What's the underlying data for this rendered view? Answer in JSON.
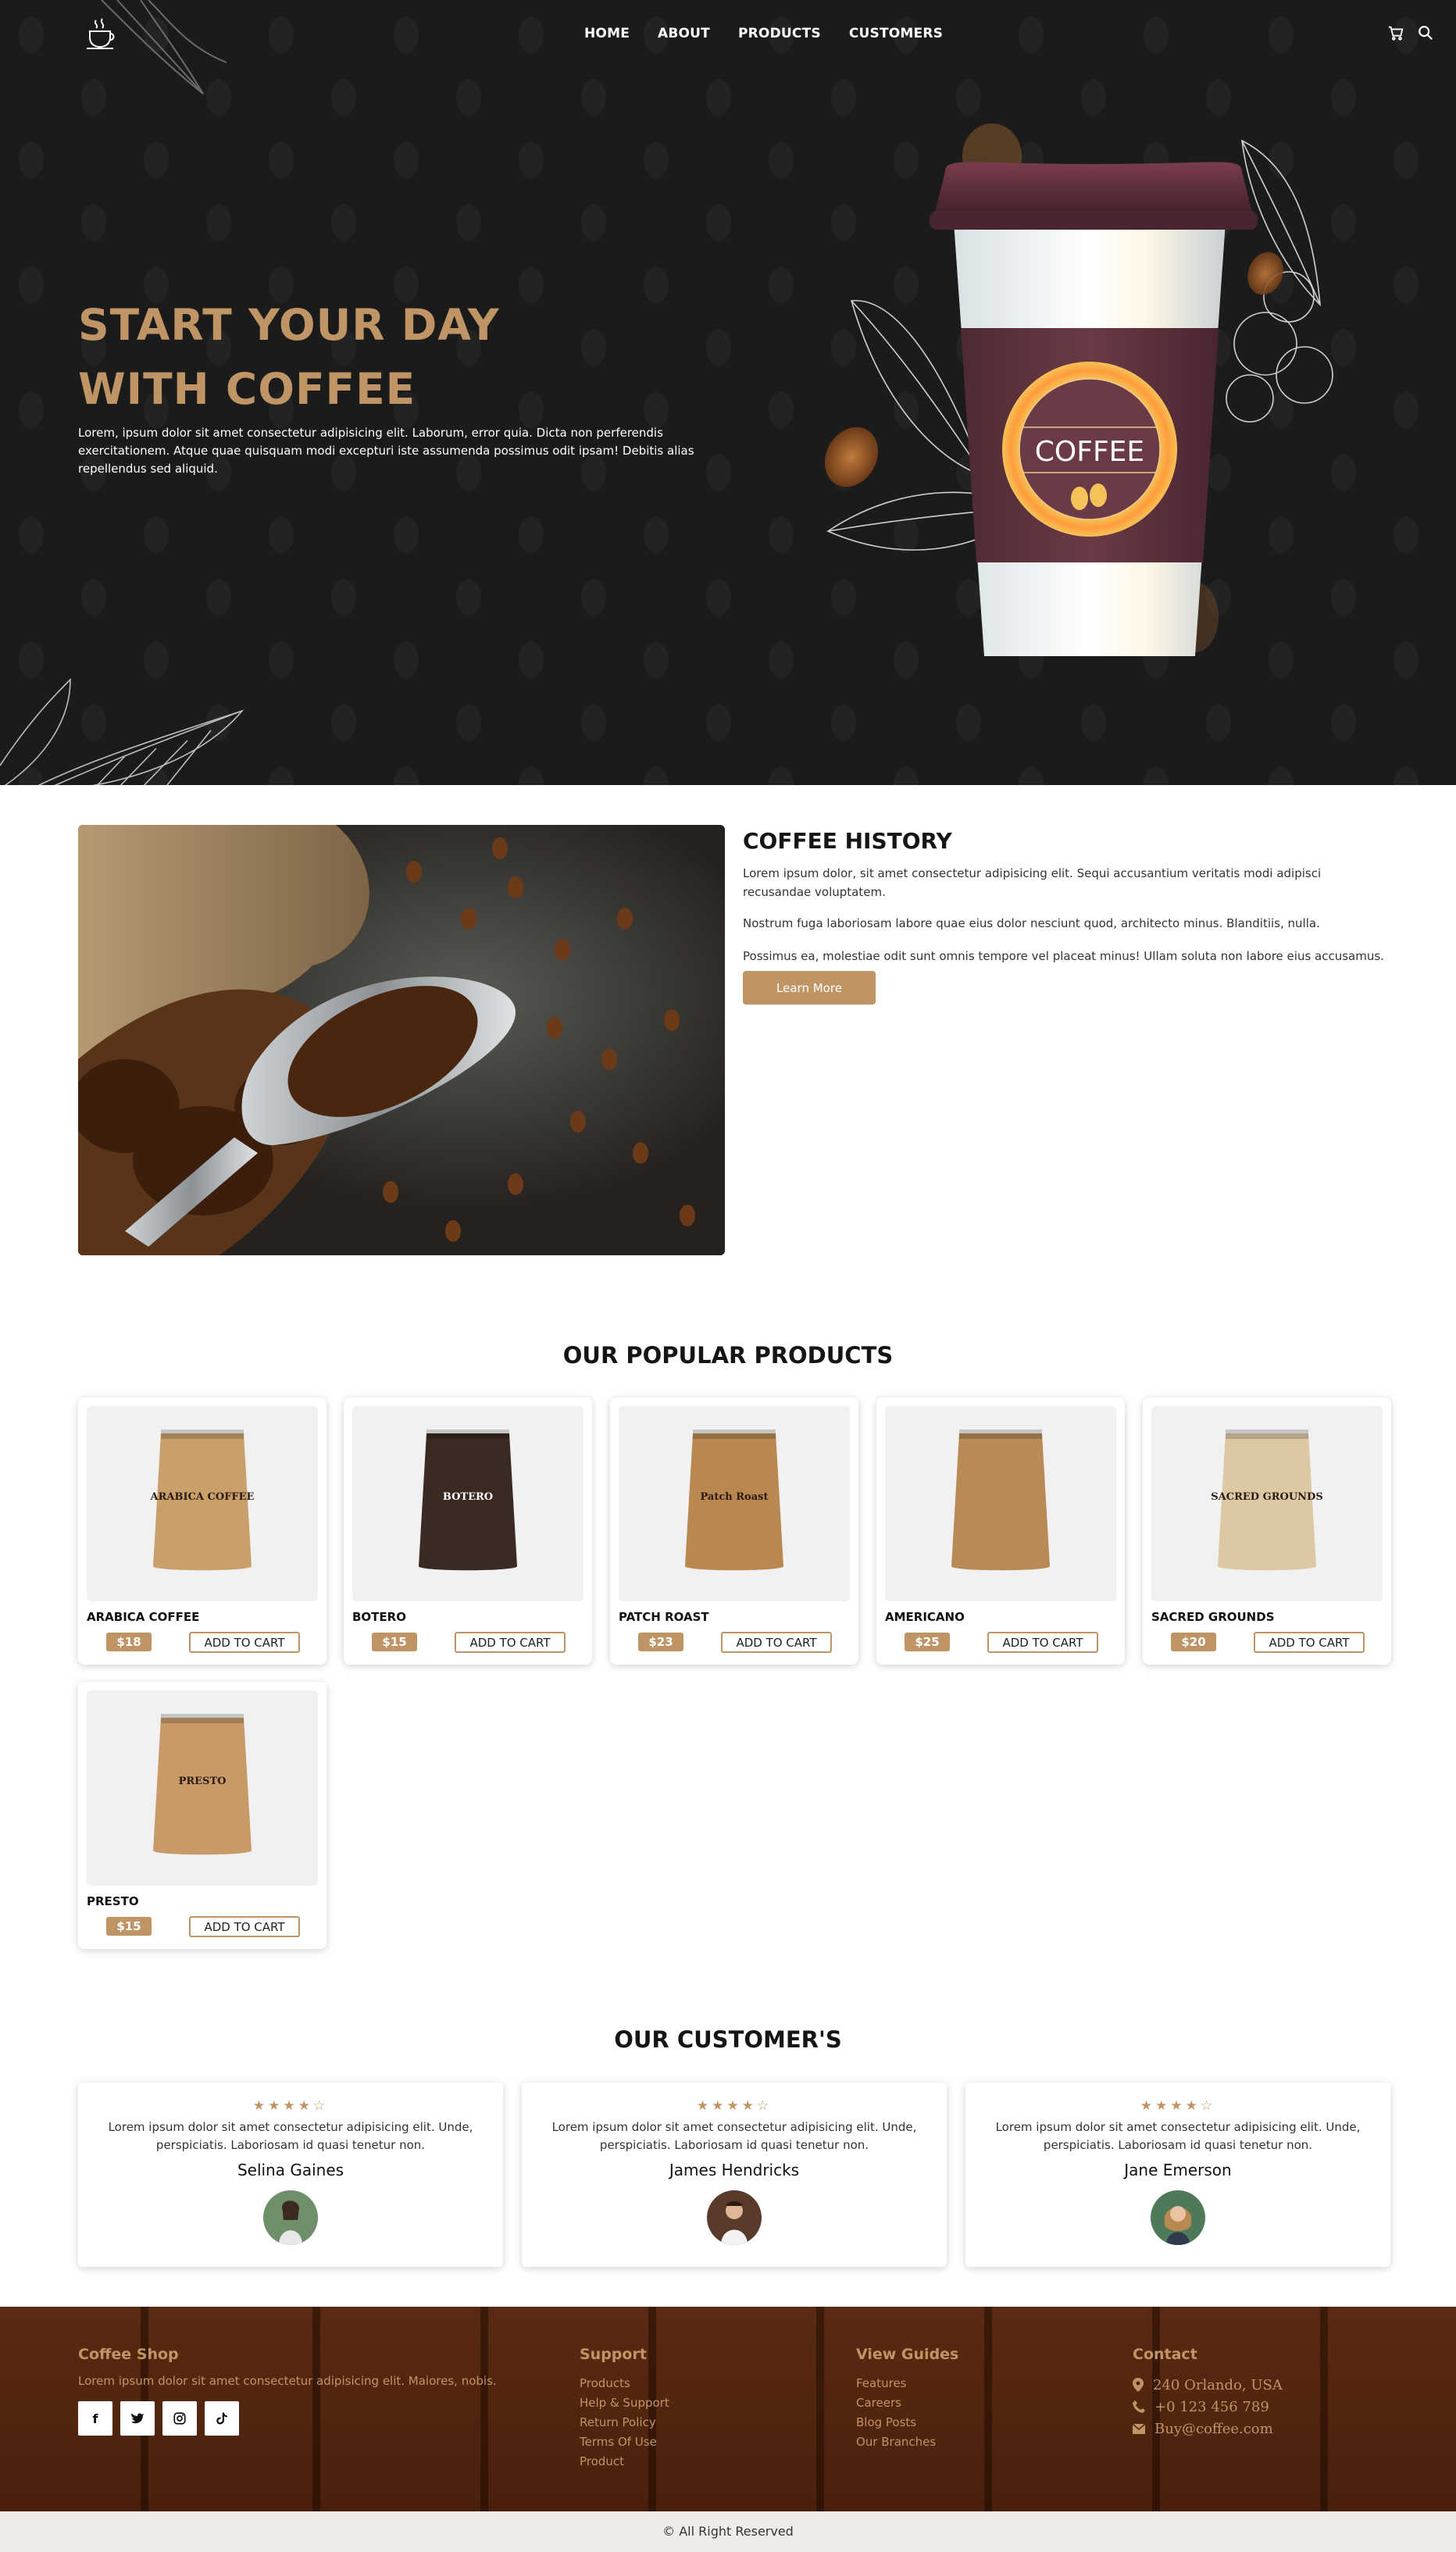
{
  "nav": {
    "links": [
      "HOME",
      "ABOUT",
      "PRODUCTS",
      "CUSTOMERS"
    ],
    "icons": [
      "cart-icon",
      "search-icon"
    ]
  },
  "hero": {
    "title_line1": "START YOUR DAY",
    "title_line2": "WITH COFFEE",
    "text": "Lorem, ipsum dolor sit amet consectetur adipisicing elit. Laborum, error quia. Dicta non perferendis exercitationem. Atque quae quisquam modi excepturi iste assumenda possimus odit ipsam! Debitis alias repellendus sed aliquid.",
    "cup_label": "COFFEE"
  },
  "history": {
    "title": "COFFEE HISTORY",
    "p1": "Lorem ipsum dolor, sit amet consectetur adipisicing elit. Sequi accusantium veritatis modi adipisci recusandae voluptatem.",
    "p2": "Nostrum fuga laboriosam labore quae eius dolor nesciunt quod, architecto minus. Blanditiis, nulla.",
    "p3": "Possimus ea, molestiae odit sunt omnis tempore vel placeat minus! Ullam soluta non labore eius accusamus.",
    "button": "Learn More"
  },
  "products": {
    "title": "OUR POPULAR PRODUCTS",
    "cart_label": "ADD TO CART",
    "items": [
      {
        "name": "ARABICA COFFEE",
        "price": "$18",
        "bag_label": "ARABICA COFFEE",
        "bag_color": "#c9a06c"
      },
      {
        "name": "BOTERO",
        "price": "$15",
        "bag_label": "BOTERO",
        "bag_color": "#3b2a22"
      },
      {
        "name": "PATCH ROAST",
        "price": "$23",
        "bag_label": "Patch Roast",
        "bag_color": "#b98750"
      },
      {
        "name": "AMERICANO",
        "price": "$25",
        "bag_label": "",
        "bag_color": "#b88a56"
      },
      {
        "name": "SACRED GROUNDS",
        "price": "$20",
        "bag_label": "SACRED GROUNDS",
        "bag_color": "#dcc9a3"
      },
      {
        "name": "PRESTO",
        "price": "$15",
        "bag_label": "PRESTO",
        "bag_color": "#c89a68"
      }
    ]
  },
  "customers": {
    "title": "OUR CUSTOMER'S",
    "stars": "★★★★☆",
    "reviews": [
      {
        "text": "Lorem ipsum dolor sit amet consectetur adipisicing elit. Unde, perspiciatis. Laboriosam id quasi tenetur non.",
        "name": "Selina Gaines"
      },
      {
        "text": "Lorem ipsum dolor sit amet consectetur adipisicing elit. Unde, perspiciatis. Laboriosam id quasi tenetur non.",
        "name": "James Hendricks"
      },
      {
        "text": "Lorem ipsum dolor sit amet consectetur adipisicing elit. Unde, perspiciatis. Laboriosam id quasi tenetur non.",
        "name": "Jane Emerson"
      }
    ]
  },
  "footer": {
    "brand": "Coffee Shop",
    "brand_text": "Lorem ipsum dolor sit amet consectetur adipisicing elit. Maiores, nobis.",
    "social": [
      "f",
      "t",
      "ig",
      "tiktok"
    ],
    "support_title": "Support",
    "support": [
      "Products",
      "Help & Support",
      "Return Policy",
      "Terms Of Use",
      "Product"
    ],
    "guides_title": "View Guides",
    "guides": [
      "Features",
      "Careers",
      "Blog Posts",
      "Our Branches"
    ],
    "contact_title": "Contact",
    "address": "240  Orlando,  USA",
    "phone": "+0  123  456  789",
    "email": "Buy@coffee.com",
    "copyright": "© All Right Reserved"
  },
  "colors": {
    "accent": "#c09565",
    "hero_bg": "#1c1b1b",
    "footer_bg": "#5a2a12"
  }
}
